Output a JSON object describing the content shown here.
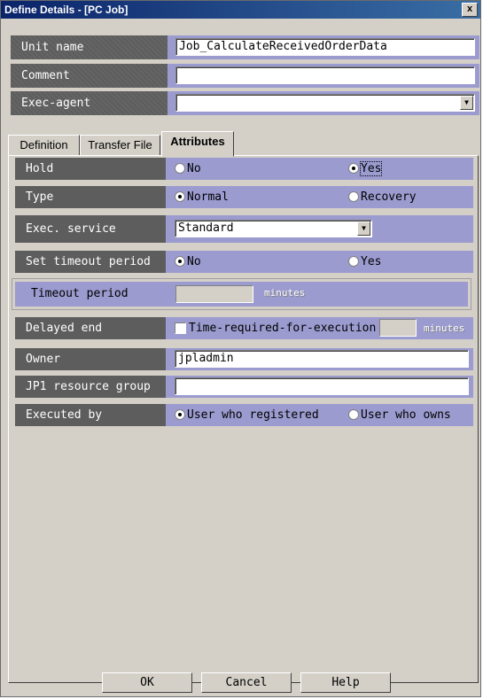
{
  "window": {
    "title": "Define Details - [PC Job]",
    "close_glyph": "x"
  },
  "header": {
    "unit_name": {
      "label": "Unit name",
      "value": "Job_CalculateReceivedOrderData"
    },
    "comment": {
      "label": "Comment",
      "value": ""
    },
    "exec_agent": {
      "label": "Exec-agent",
      "value": ""
    }
  },
  "tabs": [
    {
      "label": "Definition",
      "active": false
    },
    {
      "label": "Transfer File",
      "active": false
    },
    {
      "label": "Attributes",
      "active": true
    }
  ],
  "attributes": {
    "hold": {
      "label": "Hold",
      "options": [
        "No",
        "Yes"
      ],
      "selected": "Yes"
    },
    "type": {
      "label": "Type",
      "options": [
        "Normal",
        "Recovery"
      ],
      "selected": "Normal"
    },
    "exec_service": {
      "label": "Exec. service",
      "value": "Standard"
    },
    "set_timeout": {
      "label": "Set timeout period",
      "options": [
        "No",
        "Yes"
      ],
      "selected": "No"
    },
    "timeout_period": {
      "label": "Timeout period",
      "value": "",
      "unit": "minutes"
    },
    "delayed_end": {
      "label": "Delayed end",
      "checkbox_label": "Time-required-for-execution",
      "checked": false,
      "value": "",
      "unit": "minutes"
    },
    "owner": {
      "label": "Owner",
      "value": "jpladmin"
    },
    "jp1_resource_group": {
      "label": "JP1 resource group",
      "value": ""
    },
    "executed_by": {
      "label": "Executed by",
      "options": [
        "User who registered",
        "User who owns"
      ],
      "selected": "User who registered"
    }
  },
  "buttons": {
    "ok": "OK",
    "cancel": "Cancel",
    "help": "Help"
  },
  "colors": {
    "label_bg": "#5d5d5d",
    "row_bg": "#9b9bd0",
    "dialog_bg": "#d4d0c8",
    "title_bar": "#0a246a"
  }
}
